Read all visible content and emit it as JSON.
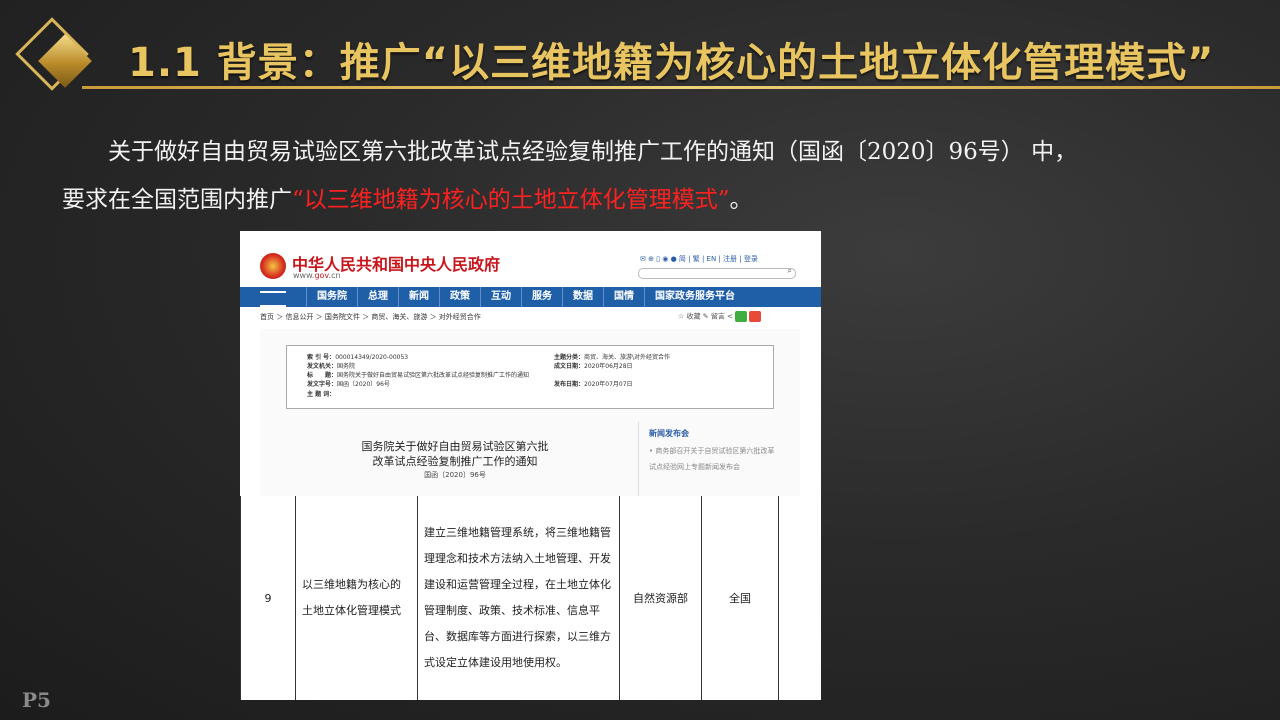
{
  "slide": {
    "title": "1.1 背景：推广“以三维地籍为核心的土地立体化管理模式”",
    "paragraph_line1": "关于做好自由贸易试验区第六批改革试点经验复制推广工作的通知（国函〔2020〕96号） 中，",
    "paragraph_line2_prefix": "要求在全国范围内推广",
    "paragraph_line2_highlight": "“以三维地籍为核心的土地立体化管理模式”",
    "paragraph_line2_suffix": "。",
    "page_number": "P5",
    "colors": {
      "title_gold": "#e8c560",
      "highlight_red": "#ff2020"
    }
  },
  "screenshot": {
    "site_name": "中华人民共和国中央人民政府",
    "site_url_prefix": "www.",
    "site_url_domain": "gov",
    "site_url_suffix": ".cn",
    "top_links": "✉ ⊕ ▯ ◉ ● 简 | 繁 | EN | 注册 | 登录",
    "search_icon": "⌕",
    "nav": [
      "国务院",
      "总理",
      "新闻",
      "政策",
      "互动",
      "服务",
      "数据",
      "国情",
      "国家政务服务平台"
    ],
    "breadcrumb": "首页 ＞ 信息公开 ＞ 国务院文件 ＞ 商贸、海关、旅游 ＞ 对外经贸合作",
    "share": "☆ 收藏  ✎ 留言  <",
    "meta": {
      "index_label": "索 引 号：",
      "index_value": "000014349/2020-00053",
      "category_label": "主题分类：",
      "category_value": "商贸、海关、旅游\\对外经贸合作",
      "issuer_label": "发文机关：",
      "issuer_value": "国务院",
      "written_label": "成文日期：",
      "written_value": "2020年06月28日",
      "title_label": "标　　题：",
      "title_value": "国务院关于做好自由贸易试验区第六批改革试点经验复制推广工作的通知",
      "docno_label": "发文字号：",
      "docno_value": "国函〔2020〕96号",
      "published_label": "发布日期：",
      "published_value": "2020年07月07日",
      "keywords_label": "主 题 词："
    },
    "doc_title_line1": "国务院关于做好自由贸易试验区第六批",
    "doc_title_line2": "改革试点经验复制推广工作的通知",
    "doc_number": "国函〔2020〕96号",
    "news_title": "新闻发布会",
    "news_item": "• 商务部召开关于自贸试验区第六批改革试点经验网上专题新闻发布会",
    "table_row": {
      "no": "9",
      "name": "以三维地籍为核心的土地立体化管理模式",
      "content": "建立三维地籍管理系统，将三维地籍管理理念和技术方法纳入土地管理、开发建设和运营管理全过程，在土地立体化管理制度、政策、技术标准、信息平台、数据库等方面进行探索，以三维方式设定立体建设用地使用权。",
      "department": "自然资源部",
      "scope": "全国"
    }
  }
}
